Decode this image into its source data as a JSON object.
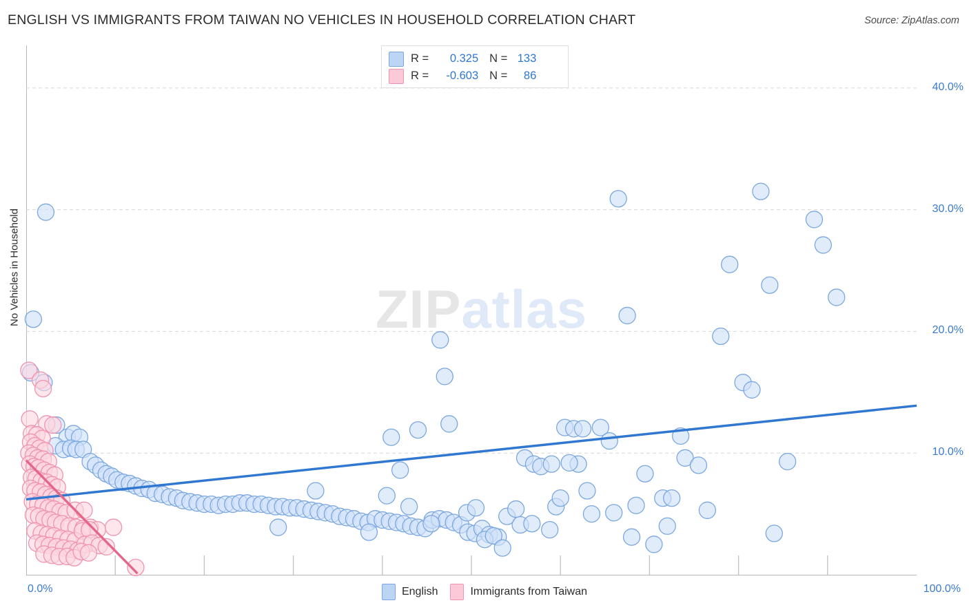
{
  "header": {
    "title": "ENGLISH VS IMMIGRANTS FROM TAIWAN NO VEHICLES IN HOUSEHOLD CORRELATION CHART",
    "source": "Source: ZipAtlas.com"
  },
  "watermark": {
    "part1": "ZIP",
    "part2": "atlas"
  },
  "correlation": {
    "rows": [
      {
        "series": "English",
        "r_label": "R =",
        "r_value": "0.325",
        "n_label": "N =",
        "n_value": "133",
        "color": "#bcd5f5"
      },
      {
        "series": "Immigrants from Taiwan",
        "r_label": "R =",
        "r_value": "-0.603",
        "n_label": "N =",
        "n_value": "86",
        "color": "#fbc9d8"
      }
    ]
  },
  "legend": {
    "items": [
      {
        "label": "English",
        "color": "#bcd5f5"
      },
      {
        "label": "Immigrants from Taiwan",
        "color": "#fbc9d8"
      }
    ]
  },
  "axes": {
    "y_title": "No Vehicles in Household",
    "y_ticks": [
      "40.0%",
      "30.0%",
      "20.0%",
      "10.0%"
    ],
    "x_ticks": [
      "0.0%",
      "100.0%"
    ]
  },
  "chart_data": {
    "type": "scatter",
    "title": "ENGLISH VS IMMIGRANTS FROM TAIWAN NO VEHICLES IN HOUSEHOLD CORRELATION CHART",
    "xlabel": "",
    "ylabel": "No Vehicles in Household",
    "xlim": [
      0,
      100
    ],
    "ylim": [
      0,
      43.5
    ],
    "x_tick_values": [
      0,
      100
    ],
    "y_tick_values": [
      10,
      20,
      30,
      40
    ],
    "grid": "horizontal-dashed",
    "legend_position": "bottom-center",
    "accent_blue": "#2f77d0",
    "accent_pink": "#e4668a",
    "series": [
      {
        "name": "English",
        "marker_fill": "#cfe0f8",
        "marker_stroke": "#7ba7e0",
        "r": 0.325,
        "n": 133,
        "trendline": {
          "x0": 0,
          "y0": 6.2,
          "x1": 100,
          "y1": 13.9,
          "color": "#2f77d0"
        },
        "points": [
          [
            2.2,
            29.8
          ],
          [
            0.8,
            21.0
          ],
          [
            0.5,
            16.6
          ],
          [
            2.0,
            15.8
          ],
          [
            3.4,
            12.3
          ],
          [
            4.6,
            11.3
          ],
          [
            5.3,
            11.6
          ],
          [
            6.0,
            11.3
          ],
          [
            3.3,
            10.6
          ],
          [
            4.2,
            10.3
          ],
          [
            5.0,
            10.4
          ],
          [
            5.6,
            10.3
          ],
          [
            6.4,
            10.3
          ],
          [
            7.2,
            9.3
          ],
          [
            7.8,
            9.0
          ],
          [
            8.4,
            8.6
          ],
          [
            9.0,
            8.3
          ],
          [
            9.6,
            8.1
          ],
          [
            10.2,
            7.8
          ],
          [
            10.9,
            7.6
          ],
          [
            11.6,
            7.5
          ],
          [
            12.3,
            7.3
          ],
          [
            13.0,
            7.1
          ],
          [
            13.8,
            7.0
          ],
          [
            14.5,
            6.7
          ],
          [
            15.3,
            6.6
          ],
          [
            16.1,
            6.4
          ],
          [
            16.9,
            6.3
          ],
          [
            17.6,
            6.1
          ],
          [
            18.4,
            6.0
          ],
          [
            19.2,
            5.9
          ],
          [
            20.0,
            5.8
          ],
          [
            20.8,
            5.8
          ],
          [
            21.6,
            5.7
          ],
          [
            22.4,
            5.8
          ],
          [
            23.2,
            5.8
          ],
          [
            24.0,
            5.9
          ],
          [
            24.8,
            5.9
          ],
          [
            25.6,
            5.8
          ],
          [
            26.4,
            5.8
          ],
          [
            27.2,
            5.7
          ],
          [
            28.0,
            5.6
          ],
          [
            28.8,
            5.6
          ],
          [
            29.6,
            5.5
          ],
          [
            30.4,
            5.5
          ],
          [
            31.2,
            5.4
          ],
          [
            32.0,
            5.3
          ],
          [
            32.8,
            5.2
          ],
          [
            33.6,
            5.1
          ],
          [
            34.4,
            5.0
          ],
          [
            35.2,
            4.8
          ],
          [
            36.0,
            4.7
          ],
          [
            36.8,
            4.6
          ],
          [
            37.6,
            4.4
          ],
          [
            38.4,
            4.3
          ],
          [
            39.2,
            4.6
          ],
          [
            40.0,
            4.5
          ],
          [
            40.8,
            4.4
          ],
          [
            41.6,
            4.3
          ],
          [
            42.4,
            4.2
          ],
          [
            43.2,
            4.0
          ],
          [
            44.0,
            3.9
          ],
          [
            44.8,
            3.8
          ],
          [
            45.6,
            4.5
          ],
          [
            46.4,
            4.6
          ],
          [
            47.2,
            4.5
          ],
          [
            48.0,
            4.3
          ],
          [
            48.8,
            4.1
          ],
          [
            49.6,
            3.5
          ],
          [
            50.4,
            3.4
          ],
          [
            51.2,
            3.8
          ],
          [
            52.0,
            3.3
          ],
          [
            53.0,
            3.1
          ],
          [
            32.5,
            6.9
          ],
          [
            28.3,
            3.9
          ],
          [
            38.5,
            3.5
          ],
          [
            40.5,
            6.5
          ],
          [
            42.0,
            8.6
          ],
          [
            43.0,
            5.6
          ],
          [
            45.5,
            4.2
          ],
          [
            41.0,
            11.3
          ],
          [
            44.0,
            11.9
          ],
          [
            46.5,
            19.3
          ],
          [
            47.5,
            12.4
          ],
          [
            49.5,
            5.1
          ],
          [
            50.5,
            5.5
          ],
          [
            51.5,
            2.9
          ],
          [
            52.5,
            3.2
          ],
          [
            47.0,
            16.3
          ],
          [
            54.0,
            4.8
          ],
          [
            55.0,
            5.4
          ],
          [
            56.0,
            9.6
          ],
          [
            57.0,
            9.1
          ],
          [
            57.8,
            8.9
          ],
          [
            58.8,
            3.7
          ],
          [
            53.5,
            2.2
          ],
          [
            59.5,
            5.6
          ],
          [
            60.5,
            12.1
          ],
          [
            61.5,
            12.0
          ],
          [
            62.5,
            12.0
          ],
          [
            64.5,
            12.1
          ],
          [
            55.5,
            4.1
          ],
          [
            56.8,
            4.2
          ],
          [
            63.5,
            5.0
          ],
          [
            60.0,
            6.3
          ],
          [
            59.0,
            9.1
          ],
          [
            62.0,
            9.1
          ],
          [
            61.0,
            9.2
          ],
          [
            63.0,
            6.9
          ],
          [
            65.5,
            11.0
          ],
          [
            66.5,
            30.9
          ],
          [
            67.5,
            21.3
          ],
          [
            68.5,
            5.7
          ],
          [
            69.5,
            8.3
          ],
          [
            70.5,
            2.5
          ],
          [
            71.5,
            6.3
          ],
          [
            72.5,
            6.3
          ],
          [
            73.5,
            11.4
          ],
          [
            74.0,
            9.6
          ],
          [
            75.5,
            9.0
          ],
          [
            76.5,
            5.3
          ],
          [
            78.0,
            19.6
          ],
          [
            79.0,
            25.5
          ],
          [
            80.5,
            15.8
          ],
          [
            81.5,
            15.2
          ],
          [
            82.5,
            31.5
          ],
          [
            83.5,
            23.8
          ],
          [
            84.0,
            3.4
          ],
          [
            85.5,
            9.3
          ],
          [
            88.5,
            29.2
          ],
          [
            89.5,
            27.1
          ],
          [
            91.0,
            22.8
          ],
          [
            66.0,
            5.1
          ],
          [
            72.0,
            4.0
          ],
          [
            68.0,
            3.1
          ]
        ]
      },
      {
        "name": "Immigrants from Taiwan",
        "marker_fill": "#fbd6e1",
        "marker_stroke": "#ef93ae",
        "r": -0.603,
        "n": 86,
        "trendline": {
          "x0": 0,
          "y0": 9.4,
          "x1": 12.5,
          "y1": 0.1,
          "color": "#e4668a"
        },
        "points": [
          [
            0.3,
            16.8
          ],
          [
            1.6,
            16.0
          ],
          [
            1.9,
            15.3
          ],
          [
            0.4,
            12.8
          ],
          [
            2.3,
            12.4
          ],
          [
            3.0,
            12.3
          ],
          [
            0.6,
            11.6
          ],
          [
            1.2,
            11.5
          ],
          [
            1.8,
            11.2
          ],
          [
            0.5,
            10.9
          ],
          [
            1.0,
            10.6
          ],
          [
            1.5,
            10.4
          ],
          [
            2.1,
            10.2
          ],
          [
            0.3,
            10.0
          ],
          [
            0.8,
            9.8
          ],
          [
            1.3,
            9.6
          ],
          [
            1.9,
            9.5
          ],
          [
            2.5,
            9.3
          ],
          [
            0.4,
            9.1
          ],
          [
            0.9,
            8.9
          ],
          [
            1.4,
            8.8
          ],
          [
            2.0,
            8.6
          ],
          [
            2.6,
            8.4
          ],
          [
            3.2,
            8.2
          ],
          [
            0.6,
            8.0
          ],
          [
            1.1,
            7.9
          ],
          [
            1.7,
            7.7
          ],
          [
            2.3,
            7.6
          ],
          [
            2.9,
            7.4
          ],
          [
            3.5,
            7.2
          ],
          [
            0.5,
            7.1
          ],
          [
            1.0,
            6.9
          ],
          [
            1.6,
            6.8
          ],
          [
            2.2,
            6.6
          ],
          [
            2.8,
            6.4
          ],
          [
            3.4,
            6.3
          ],
          [
            4.0,
            6.1
          ],
          [
            0.7,
            6.0
          ],
          [
            1.3,
            5.8
          ],
          [
            1.9,
            5.7
          ],
          [
            2.5,
            5.5
          ],
          [
            3.1,
            5.4
          ],
          [
            3.8,
            5.2
          ],
          [
            4.5,
            5.1
          ],
          [
            5.5,
            5.3
          ],
          [
            6.5,
            5.3
          ],
          [
            0.8,
            4.9
          ],
          [
            1.4,
            4.8
          ],
          [
            2.0,
            4.6
          ],
          [
            2.7,
            4.5
          ],
          [
            3.3,
            4.3
          ],
          [
            4.0,
            4.2
          ],
          [
            4.8,
            4.0
          ],
          [
            5.6,
            3.9
          ],
          [
            6.4,
            3.8
          ],
          [
            7.2,
            3.9
          ],
          [
            8.0,
            3.7
          ],
          [
            1.0,
            3.6
          ],
          [
            1.7,
            3.4
          ],
          [
            2.4,
            3.3
          ],
          [
            3.1,
            3.2
          ],
          [
            3.9,
            3.0
          ],
          [
            4.7,
            2.9
          ],
          [
            5.5,
            2.8
          ],
          [
            6.3,
            3.6
          ],
          [
            7.1,
            3.7
          ],
          [
            1.2,
            2.6
          ],
          [
            1.9,
            2.5
          ],
          [
            2.6,
            2.4
          ],
          [
            3.4,
            2.3
          ],
          [
            4.2,
            2.2
          ],
          [
            5.0,
            2.1
          ],
          [
            5.8,
            2.0
          ],
          [
            6.6,
            2.5
          ],
          [
            7.4,
            2.6
          ],
          [
            8.2,
            2.4
          ],
          [
            9.0,
            2.3
          ],
          [
            2.0,
            1.7
          ],
          [
            2.9,
            1.6
          ],
          [
            3.7,
            1.5
          ],
          [
            4.6,
            1.5
          ],
          [
            5.4,
            1.4
          ],
          [
            6.2,
            1.9
          ],
          [
            7.0,
            1.8
          ],
          [
            9.8,
            3.9
          ],
          [
            12.3,
            0.6
          ]
        ]
      }
    ]
  }
}
